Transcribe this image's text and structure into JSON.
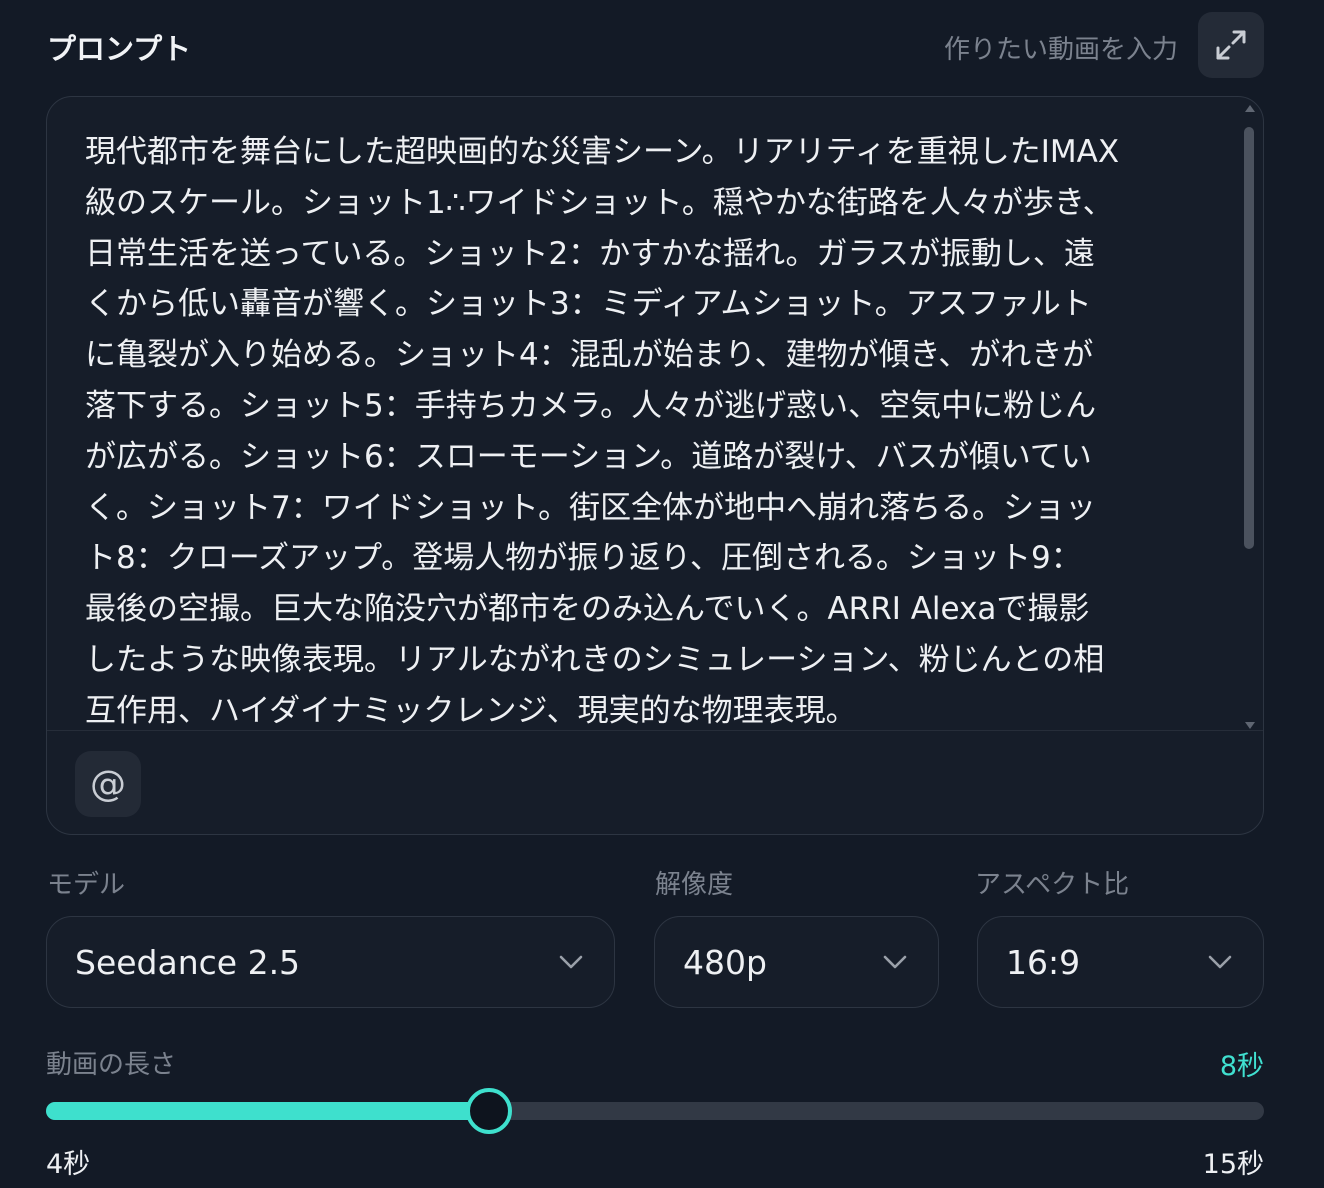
{
  "header": {
    "title": "プロンプト",
    "hint": "作りたい動画を入力",
    "expand_icon": "expand-icon"
  },
  "prompt": {
    "lines": [
      "現代都市を舞台にした超映画的な災害シーン。リアリティを重視したIMAX",
      "級のスケール。ショット1∴ワイドショット。穏やかな街路を人々が歩き、",
      "日常生活を送っている。ショット2：かすかな揺れ。ガラスが振動し、遠",
      "くから低い轟音が響く。ショット3：ミディアムショット。アスファルト",
      "に亀裂が入り始める。ショット4：混乱が始まり、建物が傾き、がれきが",
      "落下する。ショット5：手持ちカメラ。人々が逃げ惑い、空気中に粉じん",
      "が広がる。ショット6：スローモーション。道路が裂け、バスが傾いてい",
      "く。ショット7：ワイドショット。街区全体が地中へ崩れ落ちる。ショッ",
      "ト8：クローズアップ。登場人物が振り返り、圧倒される。ショット9：",
      "最後の空撮。巨大な陥没穴が都市をのみ込んでいく。ARRI Alexaで撮影",
      "したような映像表現。リアルながれきのシミュレーション、粉じんとの相",
      "互作用、ハイダイナミックレンジ、現実的な物理表現。"
    ],
    "mention_symbol": "@"
  },
  "settings": {
    "model": {
      "label": "モデル",
      "value": "Seedance 2.5"
    },
    "resolution": {
      "label": "解像度",
      "value": "480p"
    },
    "aspect": {
      "label": "アスペクト比",
      "value": "16:9"
    }
  },
  "duration": {
    "label": "動画の長さ",
    "value_text": "8秒",
    "value": 8,
    "min": 4,
    "max": 15,
    "min_label": "4秒",
    "max_label": "15秒"
  },
  "colors": {
    "background": "#131a26",
    "accent": "#3ee0cd",
    "muted_text": "#7b828e"
  }
}
